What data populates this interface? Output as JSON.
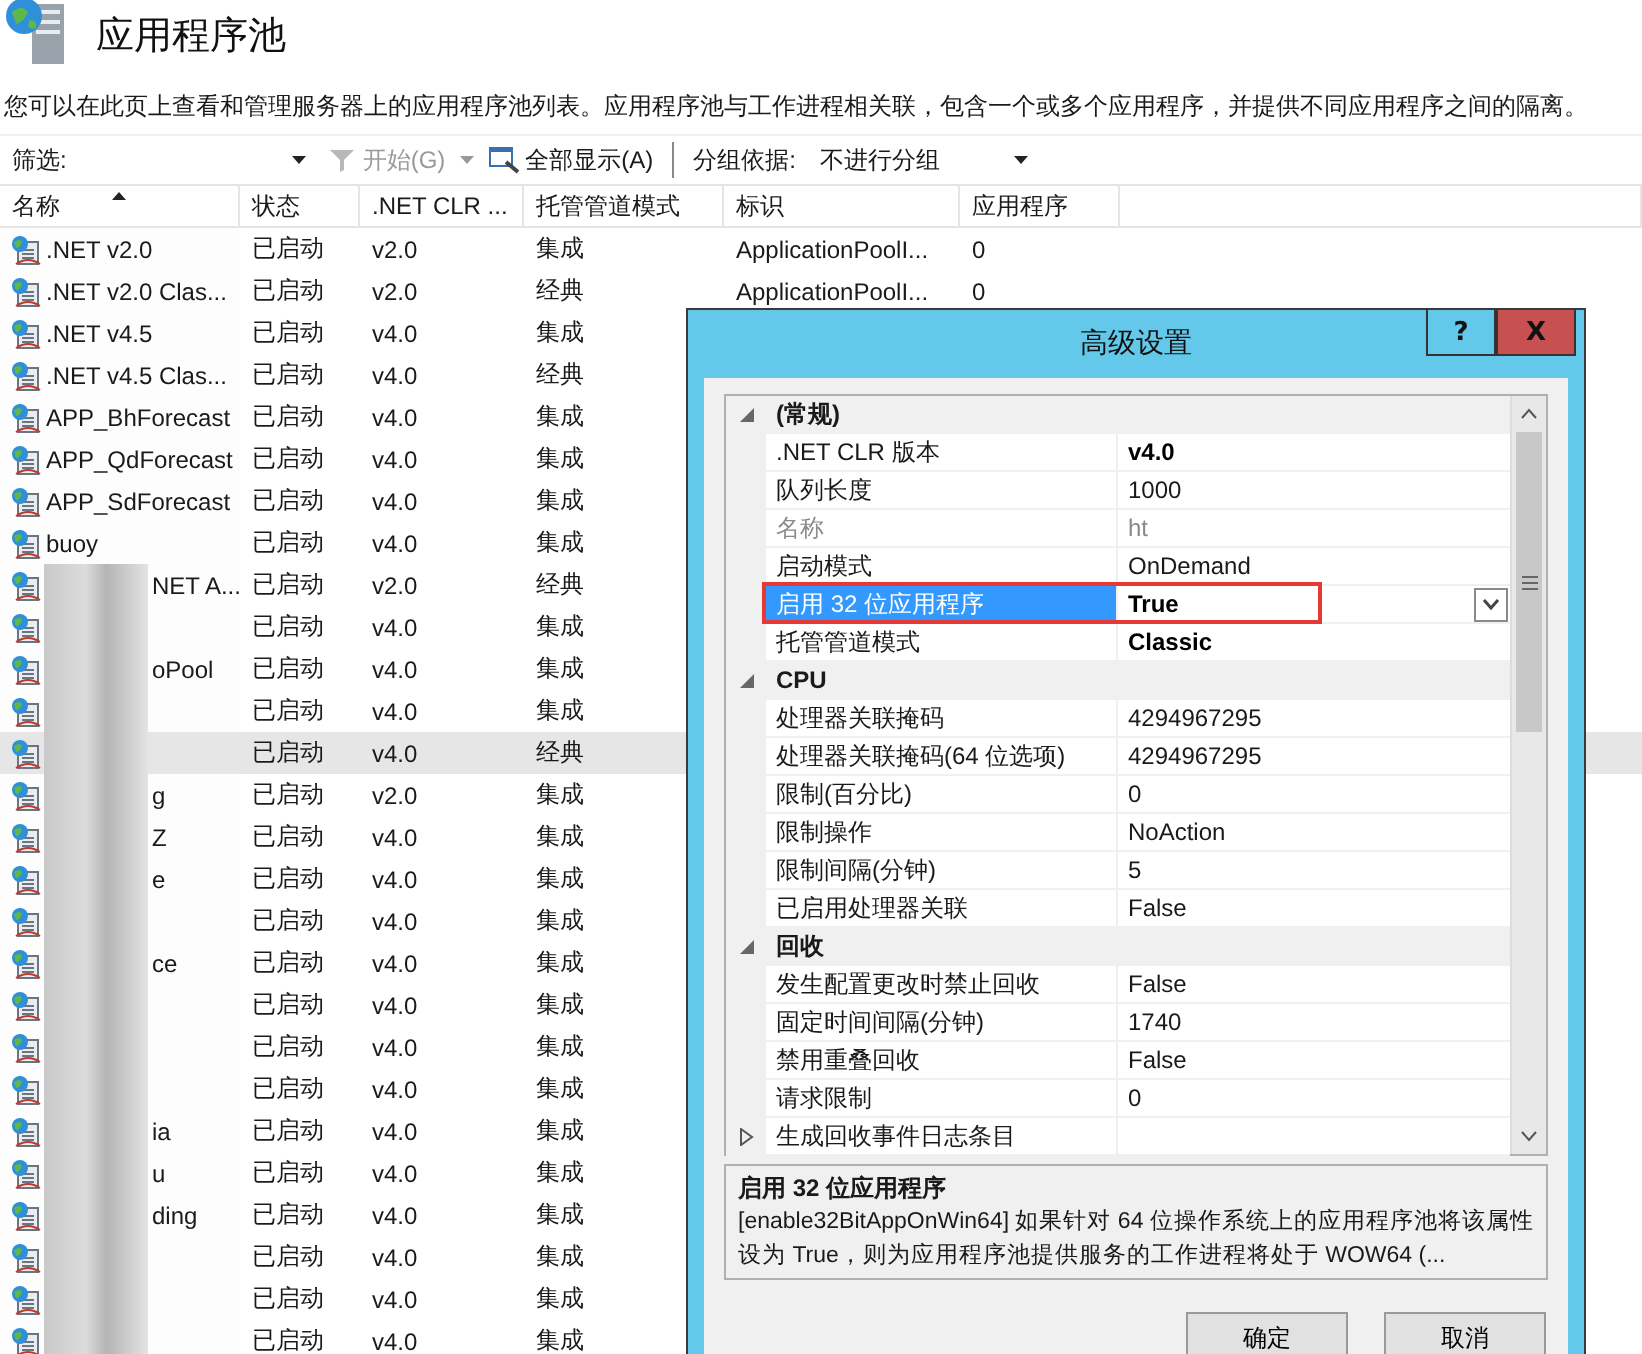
{
  "page": {
    "title": "应用程序池",
    "description": "您可以在此页上查看和管理服务器上的应用程序池列表。应用程序池与工作进程相关联，包含一个或多个应用程序，并提供不同应用程序之间的隔离。"
  },
  "toolbar": {
    "filter_label": "筛选:",
    "start_button": {
      "label": "开始(G)",
      "disabled": true
    },
    "show_all_button": "全部显示(A)",
    "group_label": "分组依据:",
    "group_value": "不进行分组"
  },
  "table": {
    "columns": [
      {
        "label": "名称",
        "sorted": true
      },
      {
        "label": "状态",
        "sorted": false
      },
      {
        "label": ".NET CLR ...",
        "sorted": false
      },
      {
        "label": "托管管道模式",
        "sorted": false
      },
      {
        "label": "标识",
        "sorted": false
      },
      {
        "label": "应用程序",
        "sorted": false
      }
    ],
    "rows": [
      {
        "name": ".NET v2.0",
        "redacted": false,
        "status": "已启动",
        "clr": "v2.0",
        "pipeline": "集成",
        "identity": "ApplicationPoolI...",
        "applications": "0",
        "selected": false
      },
      {
        "name": ".NET v2.0 Clas...",
        "redacted": false,
        "status": "已启动",
        "clr": "v2.0",
        "pipeline": "经典",
        "identity": "ApplicationPoolI...",
        "applications": "0",
        "selected": false
      },
      {
        "name": ".NET v4.5",
        "redacted": false,
        "status": "已启动",
        "clr": "v4.0",
        "pipeline": "集成",
        "selected": false
      },
      {
        "name": ".NET v4.5 Clas...",
        "redacted": false,
        "status": "已启动",
        "clr": "v4.0",
        "pipeline": "经典",
        "selected": false
      },
      {
        "name": "APP_BhForecast",
        "redacted": false,
        "status": "已启动",
        "clr": "v4.0",
        "pipeline": "集成",
        "selected": false
      },
      {
        "name": "APP_QdForecast",
        "redacted": false,
        "status": "已启动",
        "clr": "v4.0",
        "pipeline": "集成",
        "selected": false
      },
      {
        "name": "APP_SdForecast",
        "redacted": false,
        "status": "已启动",
        "clr": "v4.0",
        "pipeline": "集成",
        "selected": false
      },
      {
        "name": "buoy",
        "redacted": false,
        "status": "已启动",
        "clr": "v4.0",
        "pipeline": "集成",
        "selected": false
      },
      {
        "name": "NET A...",
        "redacted": true,
        "status": "已启动",
        "clr": "v2.0",
        "pipeline": "经典",
        "selected": false
      },
      {
        "redacted": true,
        "status": "已启动",
        "clr": "v4.0",
        "pipeline": "集成",
        "selected": false
      },
      {
        "name": "oPool",
        "redacted": true,
        "status": "已启动",
        "clr": "v4.0",
        "pipeline": "集成",
        "selected": false
      },
      {
        "redacted": true,
        "status": "已启动",
        "clr": "v4.0",
        "pipeline": "集成",
        "selected": false
      },
      {
        "redacted": true,
        "status": "已启动",
        "clr": "v4.0",
        "pipeline": "经典",
        "selected": true
      },
      {
        "name": "g",
        "redacted": true,
        "status": "已启动",
        "clr": "v2.0",
        "pipeline": "集成",
        "selected": false
      },
      {
        "name": "Z",
        "redacted": true,
        "status": "已启动",
        "clr": "v4.0",
        "pipeline": "集成",
        "selected": false
      },
      {
        "name": "e",
        "redacted": true,
        "status": "已启动",
        "clr": "v4.0",
        "pipeline": "集成",
        "selected": false
      },
      {
        "redacted": true,
        "status": "已启动",
        "clr": "v4.0",
        "pipeline": "集成",
        "selected": false
      },
      {
        "name": "ce",
        "redacted": true,
        "status": "已启动",
        "clr": "v4.0",
        "pipeline": "集成",
        "selected": false
      },
      {
        "redacted": true,
        "status": "已启动",
        "clr": "v4.0",
        "pipeline": "集成",
        "selected": false
      },
      {
        "redacted": true,
        "status": "已启动",
        "clr": "v4.0",
        "pipeline": "集成",
        "selected": false
      },
      {
        "redacted": true,
        "status": "已启动",
        "clr": "v4.0",
        "pipeline": "集成",
        "selected": false
      },
      {
        "name": "ia",
        "redacted": true,
        "status": "已启动",
        "clr": "v4.0",
        "pipeline": "集成",
        "selected": false
      },
      {
        "name": "u",
        "redacted": true,
        "status": "已启动",
        "clr": "v4.0",
        "pipeline": "集成",
        "selected": false
      },
      {
        "name": "ding",
        "redacted": true,
        "status": "已启动",
        "clr": "v4.0",
        "pipeline": "集成",
        "selected": false
      },
      {
        "redacted": true,
        "status": "已启动",
        "clr": "v4.0",
        "pipeline": "集成",
        "selected": false
      },
      {
        "redacted": true,
        "status": "已启动",
        "clr": "v4.0",
        "pipeline": "集成",
        "selected": false
      },
      {
        "redacted": true,
        "status": "已启动",
        "clr": "v4.0",
        "pipeline": "集成",
        "selected": false
      }
    ]
  },
  "dialog": {
    "title": "高级设置",
    "help_button": "?",
    "close_button": "X",
    "categories": [
      {
        "label": "(常规)",
        "expanded": true,
        "items": [
          {
            "kind": "property",
            "name": ".NET CLR 版本",
            "value": "v4.0",
            "modified": true,
            "disabled": false,
            "selected": false,
            "annotated": false
          },
          {
            "kind": "property",
            "name": "队列长度",
            "value": "1000",
            "modified": false,
            "disabled": false,
            "selected": false,
            "annotated": false
          },
          {
            "kind": "property",
            "name": "名称",
            "value": "ht",
            "modified": false,
            "disabled": true,
            "selected": false,
            "annotated": false
          },
          {
            "kind": "property",
            "name": "启动模式",
            "value": "OnDemand",
            "modified": false,
            "disabled": false,
            "selected": false,
            "annotated": false
          },
          {
            "kind": "property",
            "name": "启用 32 位应用程序",
            "value": "True",
            "modified": true,
            "disabled": false,
            "selected": true,
            "annotated": true
          },
          {
            "kind": "property",
            "name": "托管管道模式",
            "value": "Classic",
            "modified": true,
            "disabled": false,
            "selected": false,
            "annotated": false
          }
        ]
      },
      {
        "label": "CPU",
        "expanded": true,
        "items": [
          {
            "kind": "property",
            "name": "处理器关联掩码",
            "value": "4294967295",
            "modified": false,
            "disabled": false,
            "selected": false,
            "annotated": false
          },
          {
            "kind": "property",
            "name": "处理器关联掩码(64 位选项)",
            "value": "4294967295",
            "modified": false,
            "disabled": false,
            "selected": false,
            "annotated": false
          },
          {
            "kind": "property",
            "name": "限制(百分比)",
            "value": "0",
            "modified": false,
            "disabled": false,
            "selected": false,
            "annotated": false
          },
          {
            "kind": "property",
            "name": "限制操作",
            "value": "NoAction",
            "modified": false,
            "disabled": false,
            "selected": false,
            "annotated": false
          },
          {
            "kind": "property",
            "name": "限制间隔(分钟)",
            "value": "5",
            "modified": false,
            "disabled": false,
            "selected": false,
            "annotated": false
          },
          {
            "kind": "property",
            "name": "已启用处理器关联",
            "value": "False",
            "modified": false,
            "disabled": false,
            "selected": false,
            "annotated": false
          }
        ]
      },
      {
        "label": "回收",
        "expanded": true,
        "items": [
          {
            "kind": "property",
            "name": "发生配置更改时禁止回收",
            "value": "False",
            "modified": false,
            "disabled": false,
            "selected": false,
            "annotated": false
          },
          {
            "kind": "property",
            "name": "固定时间间隔(分钟)",
            "value": "1740",
            "modified": false,
            "disabled": false,
            "selected": false,
            "annotated": false
          },
          {
            "kind": "property",
            "name": "禁用重叠回收",
            "value": "False",
            "modified": false,
            "disabled": false,
            "selected": false,
            "annotated": false
          },
          {
            "kind": "property",
            "name": "请求限制",
            "value": "0",
            "modified": false,
            "disabled": false,
            "selected": false,
            "annotated": false
          },
          {
            "kind": "group",
            "name": "生成回收事件日志条目",
            "disabled": false,
            "selected": false,
            "annotated": false
          }
        ]
      }
    ],
    "description": {
      "title": "启用 32 位应用程序",
      "text": "[enable32BitAppOnWin64] 如果针对 64 位操作系统上的应用程序池将该属性设为 True，则为应用程序池提供服务的工作进程将处于 WOW64 (..."
    },
    "buttons": [
      "确定",
      "取消"
    ]
  }
}
